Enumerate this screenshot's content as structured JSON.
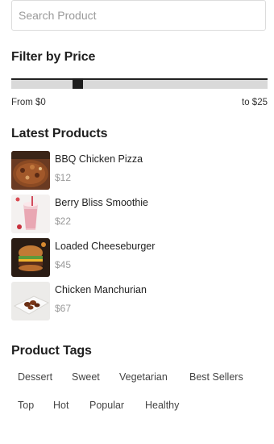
{
  "search": {
    "placeholder": "Search Product",
    "value": ""
  },
  "price_filter": {
    "title": "Filter by Price",
    "from_label": "From $0",
    "to_label": "to $25",
    "min": 0,
    "max": 25,
    "handle_position_fraction": 0.25
  },
  "latest": {
    "title": "Latest Products",
    "items": [
      {
        "name": "BBQ Chicken Pizza",
        "price": "$12",
        "thumb": "pizza"
      },
      {
        "name": "Berry Bliss Smoothie",
        "price": "$22",
        "thumb": "smoothie"
      },
      {
        "name": "Loaded Cheeseburger",
        "price": "$45",
        "thumb": "burger"
      },
      {
        "name": "Chicken Manchurian",
        "price": "$67",
        "thumb": "manchurian"
      }
    ]
  },
  "tags": {
    "title": "Product Tags",
    "items": [
      "Dessert",
      "Sweet",
      "Vegetarian",
      "Best Sellers",
      "Top",
      "Hot",
      "Popular",
      "Healthy"
    ]
  }
}
